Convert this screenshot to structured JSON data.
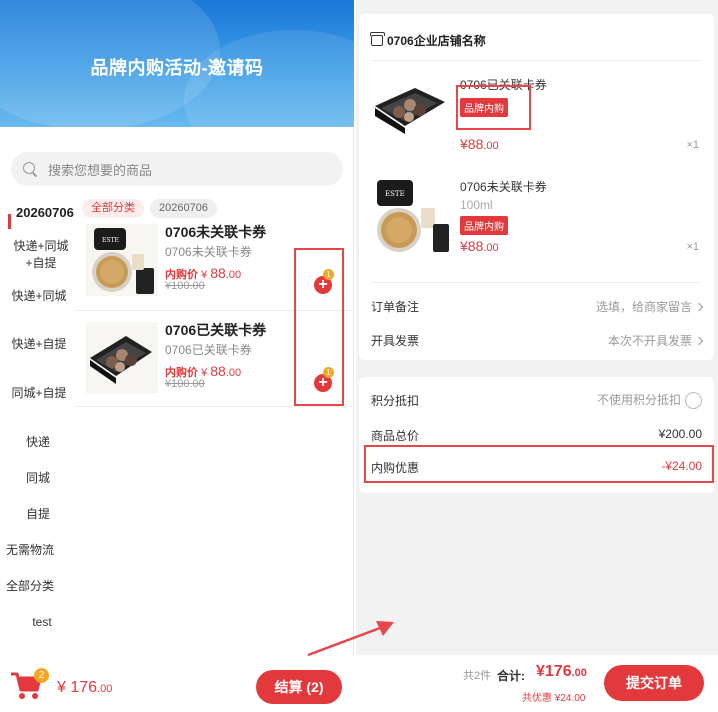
{
  "left": {
    "banner_title": "品牌内购活动-邀请码",
    "search_placeholder": "搜索您想要的商品",
    "categories": [
      {
        "label": "20260706",
        "active": true
      },
      {
        "label": "快递+同城+自提"
      },
      {
        "label": "快递+同城"
      },
      {
        "label": "快递+自提"
      },
      {
        "label": "同城+自提"
      },
      {
        "label": "快递"
      },
      {
        "label": "同城"
      },
      {
        "label": "自提"
      },
      {
        "label": "无需物流"
      },
      {
        "label": "全部分类"
      },
      {
        "label": "test"
      }
    ],
    "chips": [
      "全部分类",
      "20260706"
    ],
    "products": [
      {
        "name": "0706未关联卡券",
        "sub": "0706未关联卡券",
        "price_label": "内购价",
        "price_symbol": "¥",
        "price_int": "88",
        "price_dec": ".00",
        "orig_price": "¥100.00",
        "cart_count": "1",
        "image": "cushion-compact"
      },
      {
        "name": "0706已关联卡券",
        "sub": "0706已关联卡券",
        "price_label": "内购价",
        "price_symbol": "¥",
        "price_int": "88",
        "price_dec": ".00",
        "orig_price": "¥100.00",
        "cart_count": "1",
        "image": "eyeshadow-palette"
      }
    ],
    "cart_badge": "2",
    "cart_total_int": "¥ 176",
    "cart_total_dec": ".00",
    "checkout_label": "结算 (2)"
  },
  "right": {
    "shop_name": "0706企业店铺名称",
    "items": [
      {
        "name": "0706已关联卡券",
        "spec": "",
        "tag": "品牌内购",
        "price_int": "¥88",
        "price_dec": ".00",
        "qty": "×1",
        "image": "eyeshadow-palette"
      },
      {
        "name": "0706未关联卡券",
        "spec": "100ml",
        "tag": "品牌内购",
        "price_int": "¥88",
        "price_dec": ".00",
        "qty": "×1",
        "image": "cushion-compact"
      }
    ],
    "order_note_label": "订单备注",
    "order_note_value": "选填，给商家留言",
    "invoice_label": "开具发票",
    "invoice_value": "本次不开具发票",
    "points_label": "积分抵扣",
    "points_value": "不使用积分抵扣",
    "total_label": "商品总价",
    "total_value": "¥200.00",
    "discount_label": "内购优惠",
    "discount_value": "-¥24.00",
    "count_label": "共2件",
    "sum_label": "合计:",
    "sum_int": "¥176",
    "sum_dec": ".00",
    "saved_label": "共优惠 ¥24.00",
    "submit_label": "提交订单"
  },
  "colors": {
    "accent": "#e4393c",
    "banner": "#2a86dc",
    "highlight": "#e8474a",
    "badge": "#f5a623"
  }
}
